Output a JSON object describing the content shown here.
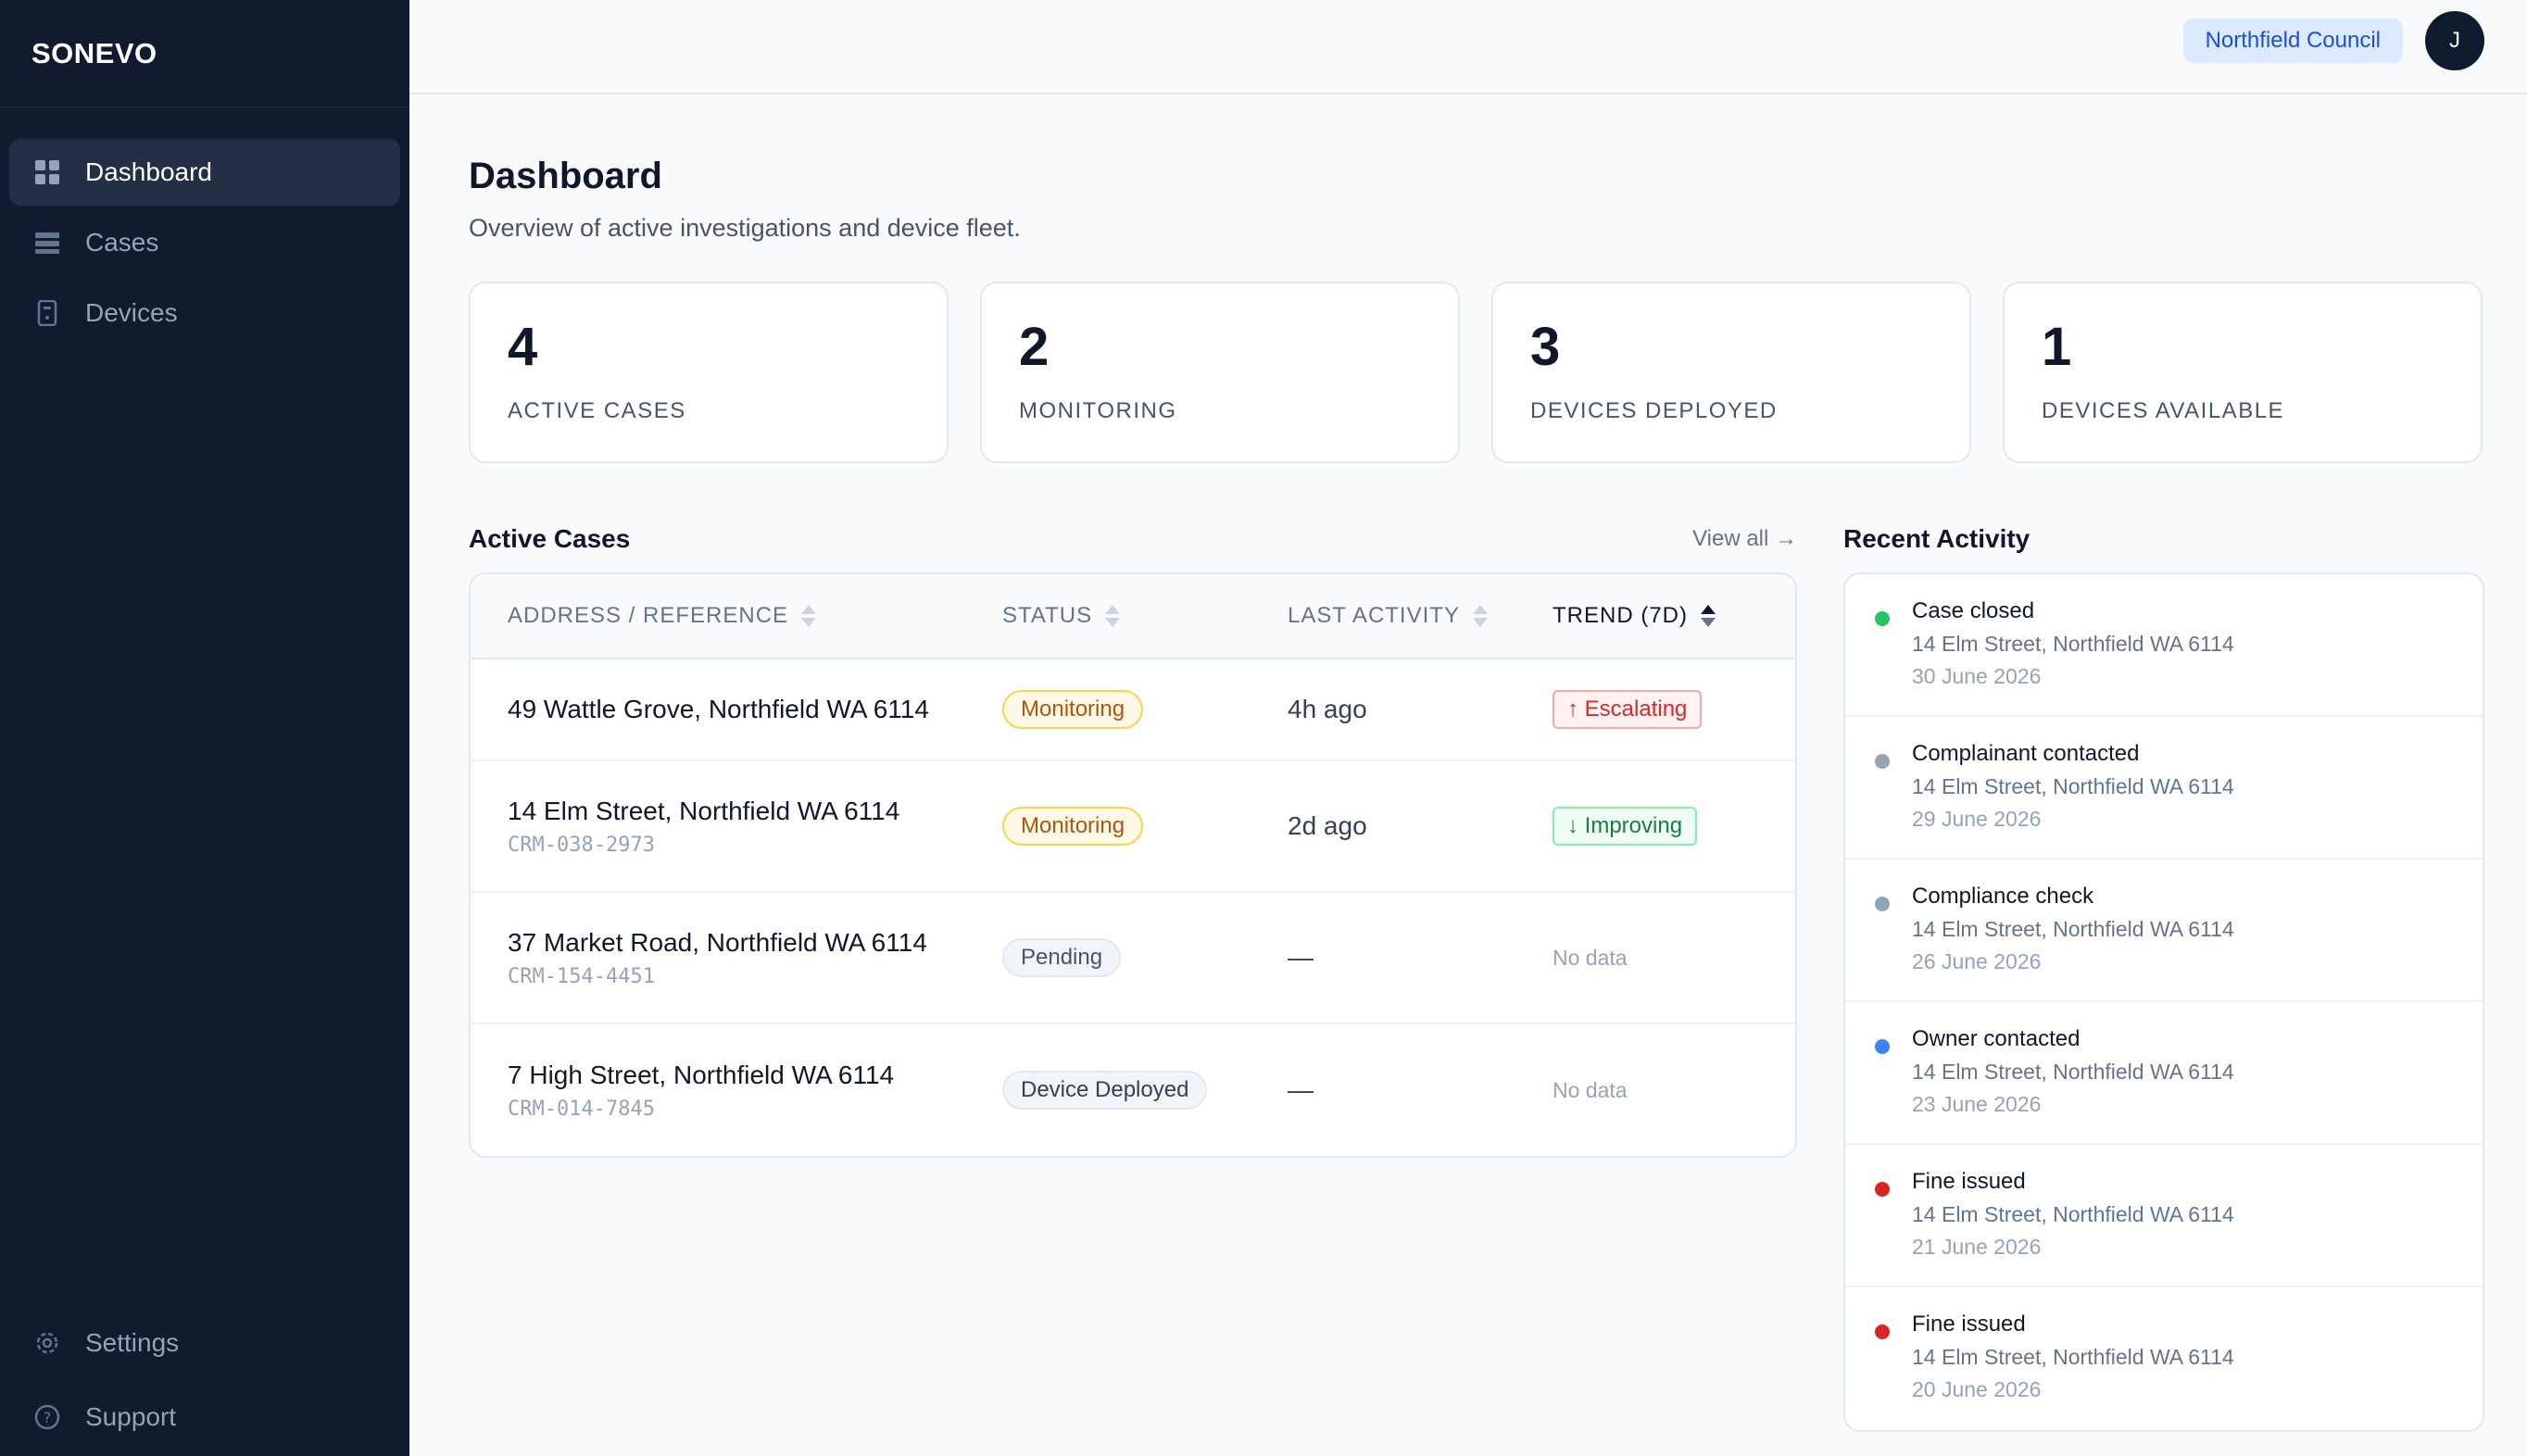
{
  "app": {
    "brand": "SONEVO"
  },
  "sidebar": {
    "items": [
      {
        "label": "Dashboard",
        "icon": "grid-icon",
        "active": true
      },
      {
        "label": "Cases",
        "icon": "list-icon",
        "active": false
      },
      {
        "label": "Devices",
        "icon": "device-icon",
        "active": false
      }
    ],
    "bottom": [
      {
        "label": "Settings",
        "icon": "gear-icon"
      },
      {
        "label": "Support",
        "icon": "help-icon"
      }
    ]
  },
  "topbar": {
    "org": "Northfield Council",
    "avatar": "J"
  },
  "page": {
    "title": "Dashboard",
    "subtitle": "Overview of active investigations and device fleet."
  },
  "stats": [
    {
      "value": "4",
      "label": "ACTIVE CASES"
    },
    {
      "value": "2",
      "label": "MONITORING"
    },
    {
      "value": "3",
      "label": "DEVICES DEPLOYED"
    },
    {
      "value": "1",
      "label": "DEVICES AVAILABLE"
    }
  ],
  "cases": {
    "title": "Active Cases",
    "view_all": "View all →",
    "columns": [
      "ADDRESS / REFERENCE",
      "STATUS",
      "LAST ACTIVITY",
      "TREND (7D)"
    ],
    "rows": [
      {
        "address": "49 Wattle Grove, Northfield WA 6114",
        "ref": "",
        "status": "Monitoring",
        "last": "4h ago",
        "trend": "↑ Escalating",
        "trend_type": "up"
      },
      {
        "address": "14 Elm Street, Northfield WA 6114",
        "ref": "CRM-038-2973",
        "status": "Monitoring",
        "last": "2d ago",
        "trend": "↓ Improving",
        "trend_type": "down"
      },
      {
        "address": "37 Market Road, Northfield WA 6114",
        "ref": "CRM-154-4451",
        "status": "Pending",
        "last": "—",
        "trend": "No data",
        "trend_type": "none"
      },
      {
        "address": "7 High Street, Northfield WA 6114",
        "ref": "CRM-014-7845",
        "status": "Device Deployed",
        "last": "—",
        "trend": "No data",
        "trend_type": "none"
      }
    ]
  },
  "activity": {
    "title": "Recent Activity",
    "items": [
      {
        "title": "Case closed",
        "address": "14 Elm Street, Northfield WA 6114",
        "date": "30 June 2026",
        "color": "#22c55e"
      },
      {
        "title": "Complainant contacted",
        "address": "14 Elm Street, Northfield WA 6114",
        "date": "29 June 2026",
        "color": "#94a3b8"
      },
      {
        "title": "Compliance check",
        "address": "14 Elm Street, Northfield WA 6114",
        "date": "26 June 2026",
        "color": "#94a3b8"
      },
      {
        "title": "Owner contacted",
        "address": "14 Elm Street, Northfield WA 6114",
        "date": "23 June 2026",
        "color": "#3b82f6"
      },
      {
        "title": "Fine issued",
        "address": "14 Elm Street, Northfield WA 6114",
        "date": "21 June 2026",
        "color": "#dc2626"
      },
      {
        "title": "Fine issued",
        "address": "14 Elm Street, Northfield WA 6114",
        "date": "20 June 2026",
        "color": "#dc2626"
      }
    ]
  }
}
